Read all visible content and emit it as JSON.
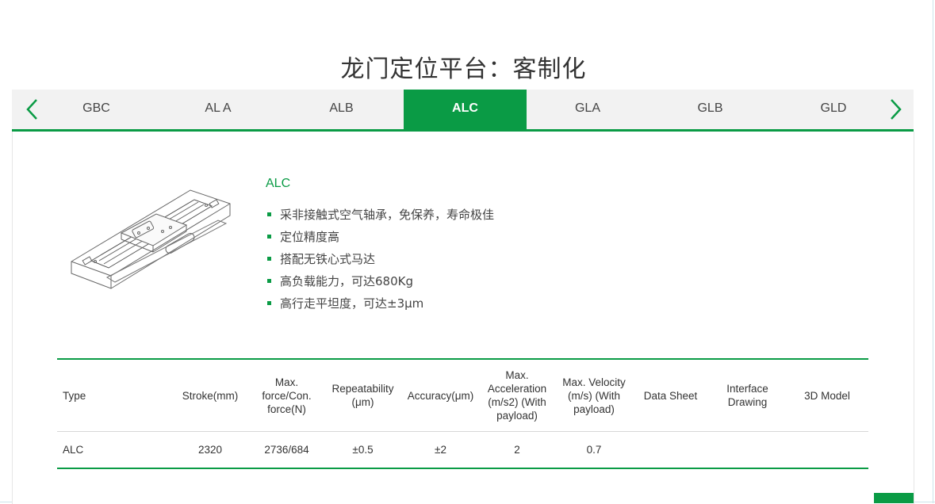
{
  "page_title": "龙门定位平台：客制化",
  "tabs": [
    {
      "label": "GBC",
      "active": false
    },
    {
      "label": "AL A",
      "active": false
    },
    {
      "label": "ALB",
      "active": false
    },
    {
      "label": "ALC",
      "active": true
    },
    {
      "label": "GLA",
      "active": false
    },
    {
      "label": "GLB",
      "active": false
    },
    {
      "label": "GLD",
      "active": false
    }
  ],
  "nav": {
    "prev_icon": "chevron-left-icon",
    "next_icon": "chevron-right-icon"
  },
  "product": {
    "name": "ALC",
    "image_icon": "linear-stage-drawing",
    "features": [
      "采非接触式空气轴承，免保养，寿命极佳",
      "定位精度高",
      "搭配无铁心式马达",
      "高负载能力，可达680Kg",
      "高行走平坦度，可达±3μm"
    ]
  },
  "table": {
    "headers": [
      "Type",
      "Stroke(mm)",
      "Max. force/Con. force(N)",
      "Repeatability (μm)",
      "Accuracy(μm)",
      "Max. Acceleration (m/s2) (With payload)",
      "Max. Velocity (m/s) (With payload)",
      "Data Sheet",
      "Interface Drawing",
      "3D Model"
    ],
    "rows": [
      [
        "ALC",
        "2320",
        "2736/684",
        "±0.5",
        "±2",
        "2",
        "0.7",
        "",
        "",
        ""
      ]
    ]
  },
  "colors": {
    "accent": "#0a9b45",
    "tab_bg": "#f2f2f2",
    "text": "#333333"
  }
}
